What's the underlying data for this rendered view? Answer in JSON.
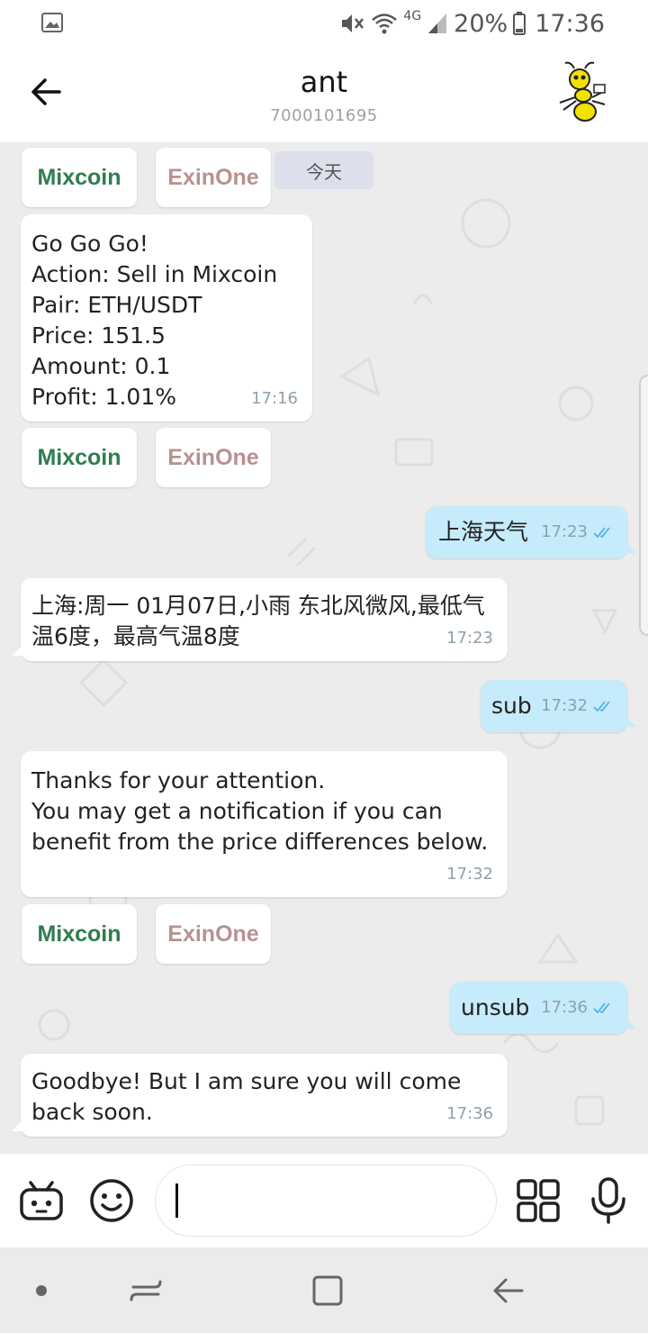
{
  "status_bar": {
    "network": "4G",
    "battery": "20%",
    "time": "17:36",
    "icons": [
      "gallery-icon",
      "mute-icon",
      "wifi-icon",
      "signal-icon",
      "battery-icon"
    ]
  },
  "header": {
    "title": "ant",
    "subtitle": "7000101695",
    "back_icon": "arrow-left-icon",
    "avatar_icon": "ant-mascot"
  },
  "chat": {
    "date_chip": "今天",
    "buttons": {
      "mixcoin": "Mixcoin",
      "exinone": "ExinOne"
    },
    "messages": [
      {
        "direction": "in",
        "text": "Go Go Go!\nAction:  Sell in Mixcoin\nPair:        ETH/USDT\nPrice:      151.5\nAmount:    0.1\nProfit:       1.01%",
        "time": "17:16"
      },
      {
        "direction": "out",
        "text": "上海天气",
        "time": "17:23",
        "status": "read"
      },
      {
        "direction": "in",
        "text": "上海:周一 01月07日,小雨 东北风微风,最低气温6度，最高气温8度",
        "time": "17:23"
      },
      {
        "direction": "out",
        "text": "sub",
        "time": "17:32",
        "status": "read"
      },
      {
        "direction": "in",
        "text": "Thanks for your attention.\n You may get a notification if you can benefit from the price differences below.",
        "time": "17:32"
      },
      {
        "direction": "out",
        "text": "unsub",
        "time": "17:36",
        "status": "read"
      },
      {
        "direction": "in",
        "text": "Goodbye! But I am sure you will come back soon.",
        "time": "17:36"
      }
    ]
  },
  "input": {
    "value": "",
    "icons": [
      "bot-icon",
      "emoji-icon",
      "apps-icon",
      "mic-icon"
    ]
  },
  "nav": {
    "icons": [
      "dot-icon",
      "recents-icon",
      "home-icon",
      "back-icon"
    ]
  },
  "colors": {
    "outgoing_bubble": "#c6ebfb",
    "chat_background": "#ececec",
    "mixcoin": "#2f7d4f",
    "exinone": "#b89190",
    "read_check": "#4fb3e8"
  }
}
